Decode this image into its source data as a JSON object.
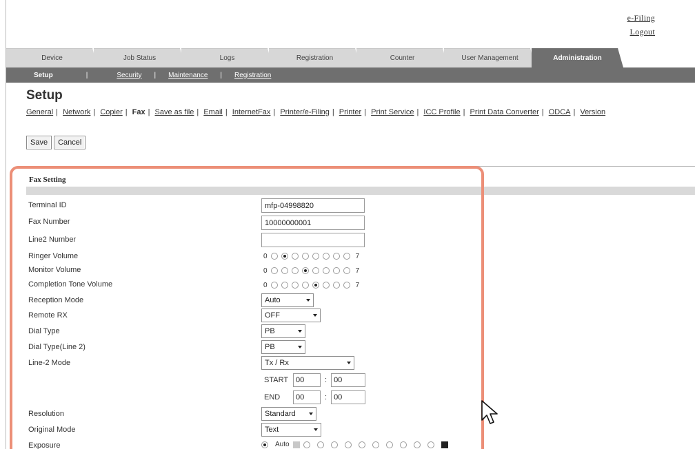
{
  "header": {
    "links": [
      "e-Filing",
      "Logout"
    ]
  },
  "tabs": [
    {
      "label": "Device",
      "active": false
    },
    {
      "label": "Job Status",
      "active": false
    },
    {
      "label": "Logs",
      "active": false
    },
    {
      "label": "Registration",
      "active": false
    },
    {
      "label": "Counter",
      "active": false
    },
    {
      "label": "User Management",
      "active": false
    },
    {
      "label": "Administration",
      "active": true
    }
  ],
  "subnav": {
    "active": "Setup",
    "links": [
      "Security",
      "Maintenance",
      "Registration"
    ],
    "separator": "|"
  },
  "page_title": "Setup",
  "settings_links": [
    "General",
    "Network",
    "Copier",
    "Fax",
    "Save as file",
    "Email",
    "InternetFax",
    "Printer/e-Filing",
    "Printer",
    "Print Service",
    "ICC Profile",
    "Print Data Converter",
    "ODCA",
    "Version"
  ],
  "settings_current": "Fax",
  "actions": {
    "save": "Save",
    "cancel": "Cancel"
  },
  "fax_setting": {
    "title": "Fax Setting",
    "terminal_id": {
      "label": "Terminal ID",
      "value": "mfp-04998820"
    },
    "fax_number": {
      "label": "Fax Number",
      "value": "10000000001"
    },
    "line2_number": {
      "label": "Line2 Number",
      "value": ""
    },
    "ringer_volume": {
      "label": "Ringer Volume",
      "min": "0",
      "max": "7",
      "selected": 1
    },
    "monitor_volume": {
      "label": "Monitor Volume",
      "min": "0",
      "max": "7",
      "selected": 3
    },
    "completion_tone_volume": {
      "label": "Completion Tone Volume",
      "min": "0",
      "max": "7",
      "selected": 4
    },
    "reception_mode": {
      "label": "Reception Mode",
      "value": "Auto"
    },
    "remote_rx": {
      "label": "Remote RX",
      "value": "OFF"
    },
    "dial_type": {
      "label": "Dial Type",
      "value": "PB"
    },
    "dial_type_line2": {
      "label": "Dial Type(Line 2)",
      "value": "PB"
    },
    "line2_mode": {
      "label": "Line-2 Mode",
      "value": "Tx / Rx",
      "start_label": "START",
      "start_hour": "00",
      "start_min": "00",
      "end_label": "END",
      "end_hour": "00",
      "end_min": "00",
      "colon": ":"
    },
    "resolution": {
      "label": "Resolution",
      "value": "Standard"
    },
    "original_mode": {
      "label": "Original Mode",
      "value": "Text"
    },
    "exposure": {
      "label": "Exposure",
      "value": "Auto"
    }
  }
}
